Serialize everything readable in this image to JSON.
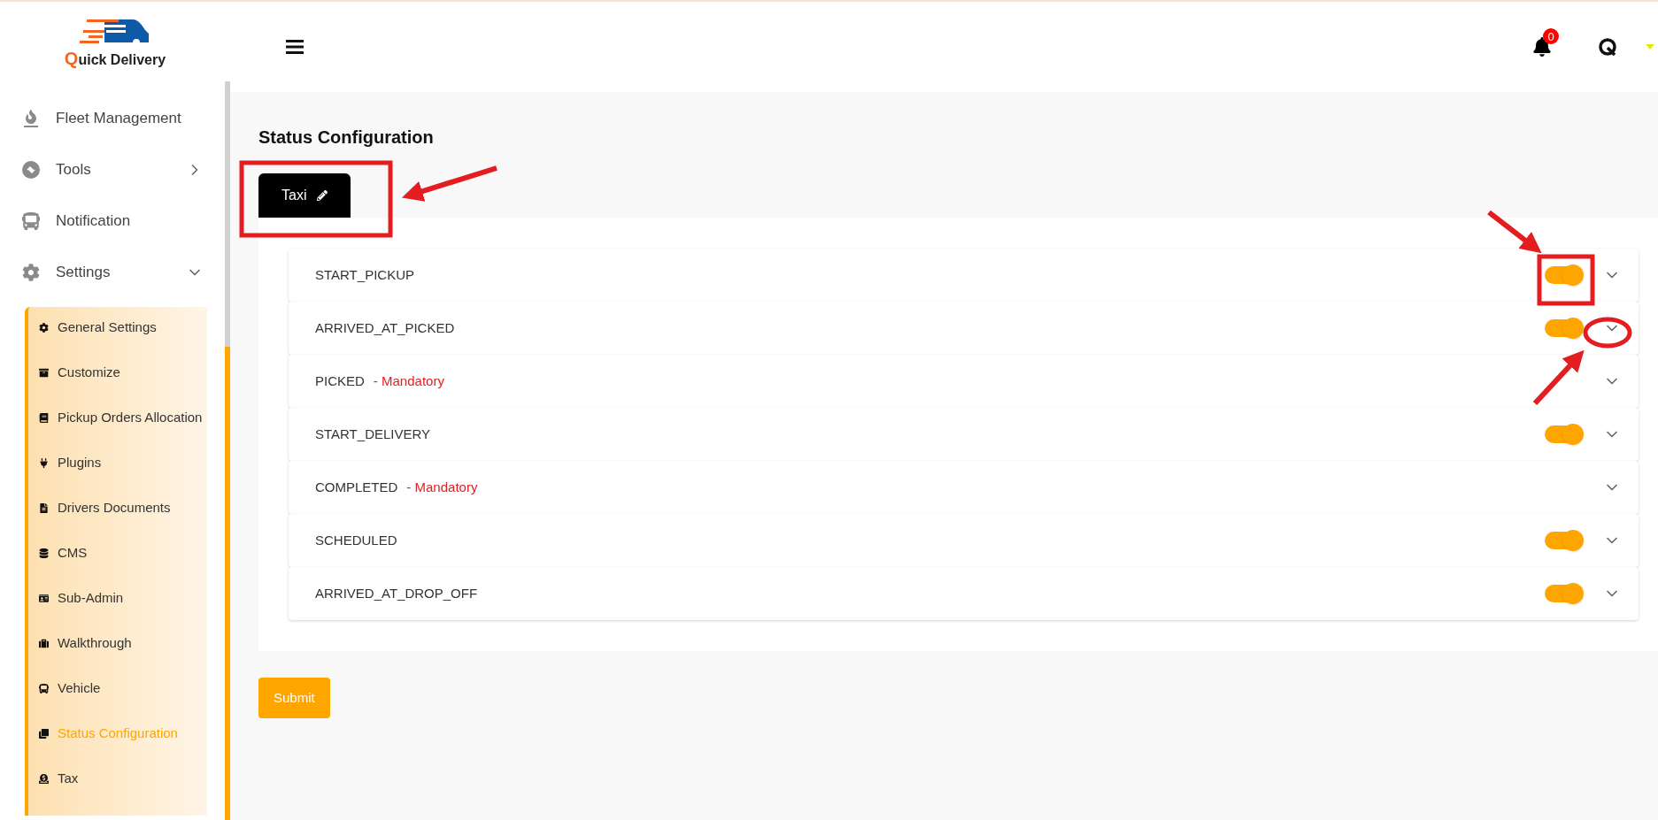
{
  "logo": {
    "text": "Quick Delivery"
  },
  "sidebar": {
    "items": [
      {
        "label": "Fleet Management"
      },
      {
        "label": "Tools",
        "expanded": false
      },
      {
        "label": "Notification"
      },
      {
        "label": "Settings",
        "expanded": true,
        "children": [
          {
            "label": "General Settings",
            "selected": false
          },
          {
            "label": "Customize",
            "selected": false
          },
          {
            "label": "Pickup Orders Allocation",
            "selected": false
          },
          {
            "label": "Plugins",
            "selected": false
          },
          {
            "label": "Drivers Documents",
            "selected": false
          },
          {
            "label": "CMS",
            "selected": false
          },
          {
            "label": "Sub-Admin",
            "selected": false
          },
          {
            "label": "Walkthrough",
            "selected": false
          },
          {
            "label": "Vehicle",
            "selected": false
          },
          {
            "label": "Status Configuration",
            "selected": true
          },
          {
            "label": "Tax",
            "selected": false
          }
        ]
      }
    ]
  },
  "header": {
    "notification_count": "0"
  },
  "page": {
    "title": "Status Configuration",
    "tabs": [
      {
        "label": "Taxi",
        "selected": true
      }
    ],
    "statuses": [
      {
        "label": "START_PICKUP",
        "kind": "toggle",
        "on": true
      },
      {
        "label": "ARRIVED_AT_PICKED",
        "kind": "toggle",
        "on": true
      },
      {
        "label": "PICKED",
        "kind": "mandatory",
        "note": "- Mandatory"
      },
      {
        "label": "START_DELIVERY",
        "kind": "toggle",
        "on": true
      },
      {
        "label": "COMPLETED",
        "kind": "mandatory",
        "note": "- Mandatory"
      },
      {
        "label": "SCHEDULED",
        "kind": "toggle",
        "on": true
      },
      {
        "label": "ARRIVED_AT_DROP_OFF",
        "kind": "toggle",
        "on": true
      }
    ],
    "submit": "Submit"
  }
}
